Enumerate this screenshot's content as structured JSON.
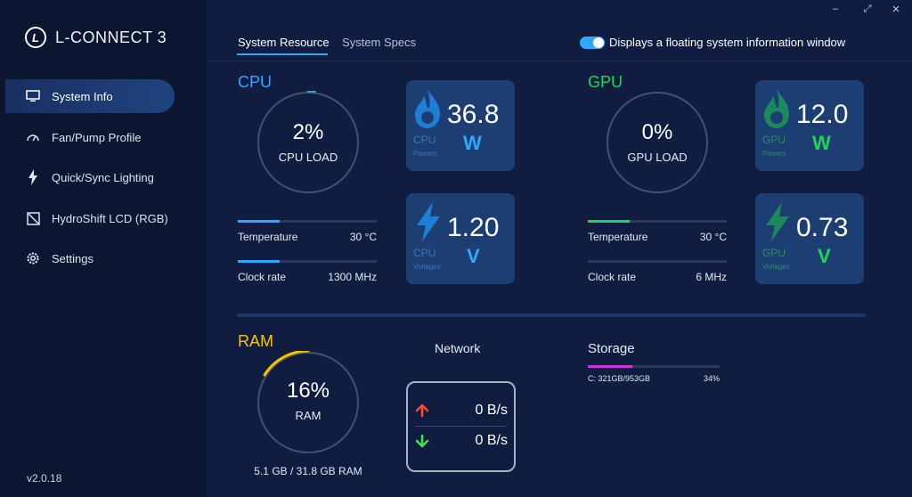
{
  "app": {
    "name": "L-CONNECT 3",
    "version": "v2.0.18"
  },
  "window_controls": {
    "minimize": "–",
    "restore": "⤢",
    "close": "✕"
  },
  "sidebar": {
    "items": [
      {
        "label": "System Info",
        "icon": "monitor-icon",
        "active": true
      },
      {
        "label": "Fan/Pump Profile",
        "icon": "gauge-icon"
      },
      {
        "label": "Quick/Sync Lighting",
        "icon": "lightning-icon"
      },
      {
        "label": "HydroShift LCD (RGB)",
        "icon": "lcd-icon"
      },
      {
        "label": "Settings",
        "icon": "gear-icon"
      }
    ]
  },
  "tabs": [
    {
      "label": "System Resource",
      "active": true
    },
    {
      "label": "System Specs"
    }
  ],
  "floating_toggle": {
    "label": "Displays a floating system information window",
    "on": true
  },
  "cpu": {
    "title": "CPU",
    "load_value": "2%",
    "load_label": "CPU LOAD",
    "load_fraction": 0.02,
    "temperature_label": "Temperature",
    "temperature_value": "30 °C",
    "temperature_fraction": 0.3,
    "clock_label": "Clock rate",
    "clock_value": "1300 MHz",
    "clock_fraction": 0.3,
    "power": {
      "value": "36.8",
      "unit": "W",
      "name": "CPU",
      "sub": "Powers"
    },
    "voltage": {
      "value": "1.20",
      "unit": "V",
      "name": "CPU",
      "sub": "Voltages"
    },
    "color": "#2fa8ff"
  },
  "gpu": {
    "title": "GPU",
    "load_value": "0%",
    "load_label": "GPU LOAD",
    "load_fraction": 0,
    "temperature_label": "Temperature",
    "temperature_value": "30 °C",
    "temperature_fraction": 0.3,
    "clock_label": "Clock rate",
    "clock_value": "6 MHz",
    "clock_fraction": 0,
    "power": {
      "value": "12.0",
      "unit": "W",
      "name": "GPU",
      "sub": "Powers"
    },
    "voltage": {
      "value": "0.73",
      "unit": "V",
      "name": "GPU",
      "sub": "Voltages"
    },
    "color": "#1fd35a"
  },
  "ram": {
    "title": "RAM",
    "value": "16%",
    "label": "RAM",
    "fraction": 0.16,
    "total": "5.1 GB / 31.8 GB RAM",
    "color": "#f5c400"
  },
  "network": {
    "title": "Network",
    "upload": "0 B/s",
    "download": "0 B/s",
    "upload_color": "#ff4a2a",
    "download_color": "#3ee84a"
  },
  "storage": {
    "title": "Storage",
    "drive": "C: 321GB/953GB",
    "percent": "34%",
    "fraction": 0.34
  }
}
